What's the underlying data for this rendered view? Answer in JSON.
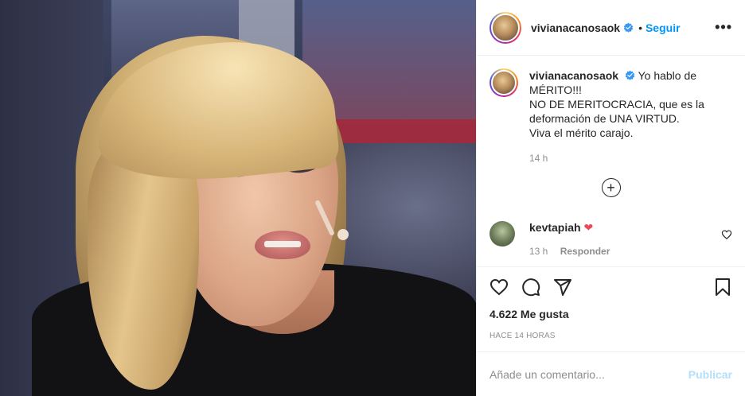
{
  "post": {
    "username": "vivianacanosaok",
    "follow_label": "Seguir",
    "dot": "•",
    "more_label": "•••",
    "caption_lines": [
      "Yo hablo de",
      "MÉRITO!!!",
      "NO DE MERITOCRACIA, que es la",
      "deformación de UNA VIRTUD.",
      "Viva el mérito carajo."
    ],
    "caption_time": "14 h",
    "load_more_icon": "plus-circle-icon"
  },
  "comments": [
    {
      "username": "kevtapiah",
      "emoji": "❤",
      "time": "13 h",
      "reply_label": "Responder"
    }
  ],
  "actions": {
    "icons": [
      "heart-icon",
      "comment-icon",
      "share-icon",
      "bookmark-icon"
    ]
  },
  "likes_text": "4.622 Me gusta",
  "time_ago": "HACE 14 HORAS",
  "add_comment": {
    "placeholder": "Añade un comentario...",
    "publish_label": "Publicar"
  },
  "colors": {
    "link_blue": "#0095f6",
    "publish_disabled": "#b2dffc",
    "heart_red": "#ed4956",
    "muted": "#8e8e8e"
  }
}
